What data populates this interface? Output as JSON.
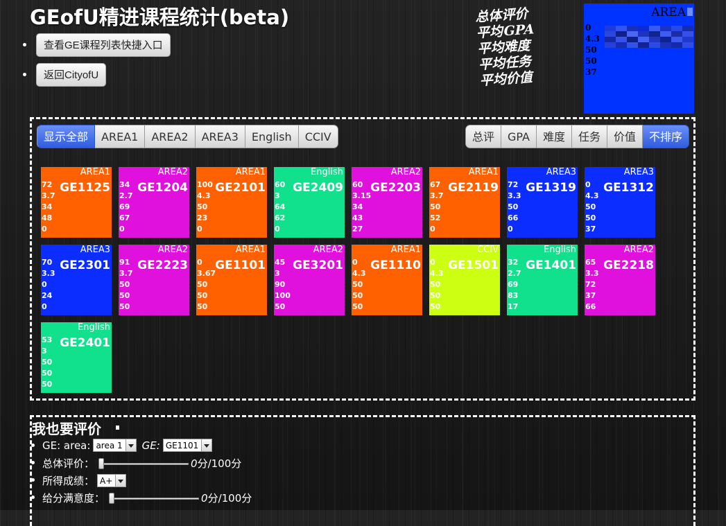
{
  "page": {
    "title": "GEofU精进课程统计(beta)"
  },
  "links": [
    {
      "label": "查看GE课程列表快捷入口"
    },
    {
      "label": "返回CityofU"
    }
  ],
  "summary": {
    "labels": [
      "总体评价",
      "平均GPA",
      "平均难度",
      "平均任务",
      "平均价值"
    ],
    "area": "AREA",
    "values": [
      "0",
      "4.3",
      "50",
      "50",
      "37"
    ],
    "box_color": "#0033ff"
  },
  "filters": {
    "areas": [
      {
        "label": "显示全部",
        "active": true
      },
      {
        "label": "AREA1",
        "active": false
      },
      {
        "label": "AREA2",
        "active": false
      },
      {
        "label": "AREA3",
        "active": false
      },
      {
        "label": "English",
        "active": false
      },
      {
        "label": "CCIV",
        "active": false
      }
    ],
    "sorts": [
      {
        "label": "总评",
        "active": false
      },
      {
        "label": "GPA",
        "active": false
      },
      {
        "label": "难度",
        "active": false
      },
      {
        "label": "任务",
        "active": false
      },
      {
        "label": "价值",
        "active": false
      },
      {
        "label": "不排序",
        "active": true
      }
    ]
  },
  "area_colors": {
    "AREA1": "#ff6000",
    "AREA2": "#e011dd",
    "AREA3": "#0c2dff",
    "English": "#11e08c",
    "CCIV": "#ccff11"
  },
  "courses": [
    {
      "area": "AREA1",
      "code": "GE1125",
      "values": [
        "72",
        "3.7",
        "34",
        "48",
        "0"
      ]
    },
    {
      "area": "AREA2",
      "code": "GE1204",
      "values": [
        "34",
        "2.7",
        "69",
        "67",
        "0"
      ]
    },
    {
      "area": "AREA1",
      "code": "GE2101",
      "values": [
        "100",
        "4.3",
        "50",
        "23",
        "0"
      ]
    },
    {
      "area": "English",
      "code": "GE2409",
      "values": [
        "60",
        "3",
        "64",
        "62",
        "0"
      ]
    },
    {
      "area": "AREA2",
      "code": "GE2203",
      "values": [
        "60",
        "3.15",
        "34",
        "43",
        "27"
      ]
    },
    {
      "area": "AREA1",
      "code": "GE2119",
      "values": [
        "67",
        "3.7",
        "50",
        "52",
        "0"
      ]
    },
    {
      "area": "AREA3",
      "code": "GE1319",
      "values": [
        "72",
        "3.3",
        "50",
        "66",
        "0"
      ]
    },
    {
      "area": "AREA3",
      "code": "GE1312",
      "values": [
        "0",
        "4.3",
        "50",
        "50",
        "37"
      ]
    },
    {
      "area": "AREA3",
      "code": "GE2301",
      "values": [
        "70",
        "3.3",
        "0",
        "24",
        "0"
      ]
    },
    {
      "area": "AREA2",
      "code": "GE2223",
      "values": [
        "91",
        "3.7",
        "50",
        "50",
        "50"
      ]
    },
    {
      "area": "AREA1",
      "code": "GE1101",
      "values": [
        "0",
        "3.67",
        "50",
        "50",
        "50"
      ]
    },
    {
      "area": "AREA2",
      "code": "GE3201",
      "values": [
        "45",
        "3",
        "90",
        "100",
        "50"
      ]
    },
    {
      "area": "AREA1",
      "code": "GE1110",
      "values": [
        "0",
        "4.3",
        "50",
        "50",
        "50"
      ]
    },
    {
      "area": "CCIV",
      "code": "GE1501",
      "values": [
        "0",
        "4.3",
        "50",
        "50",
        "50"
      ]
    },
    {
      "area": "English",
      "code": "GE1401",
      "values": [
        "32",
        "2.7",
        "69",
        "83",
        "17"
      ]
    },
    {
      "area": "AREA2",
      "code": "GE2218",
      "values": [
        "65",
        "3.3",
        "72",
        "37",
        "66"
      ]
    },
    {
      "area": "English",
      "code": "GE2401",
      "values": [
        "53",
        "3",
        "50",
        "50",
        "50"
      ]
    }
  ],
  "evaluate": {
    "title": "我也要评价",
    "area_label": "GE: area:",
    "area_selected": "area 1",
    "ge_label": "GE:",
    "ge_selected": "GE1101",
    "overall_label": "总体评价：",
    "overall_value": "0",
    "overall_unit": "分/100分",
    "grade_label": "所得成绩：",
    "grade_selected": "A+",
    "satisfaction_label": "给分满意度：",
    "satisfaction_value": "0",
    "satisfaction_unit": "分/100分"
  }
}
